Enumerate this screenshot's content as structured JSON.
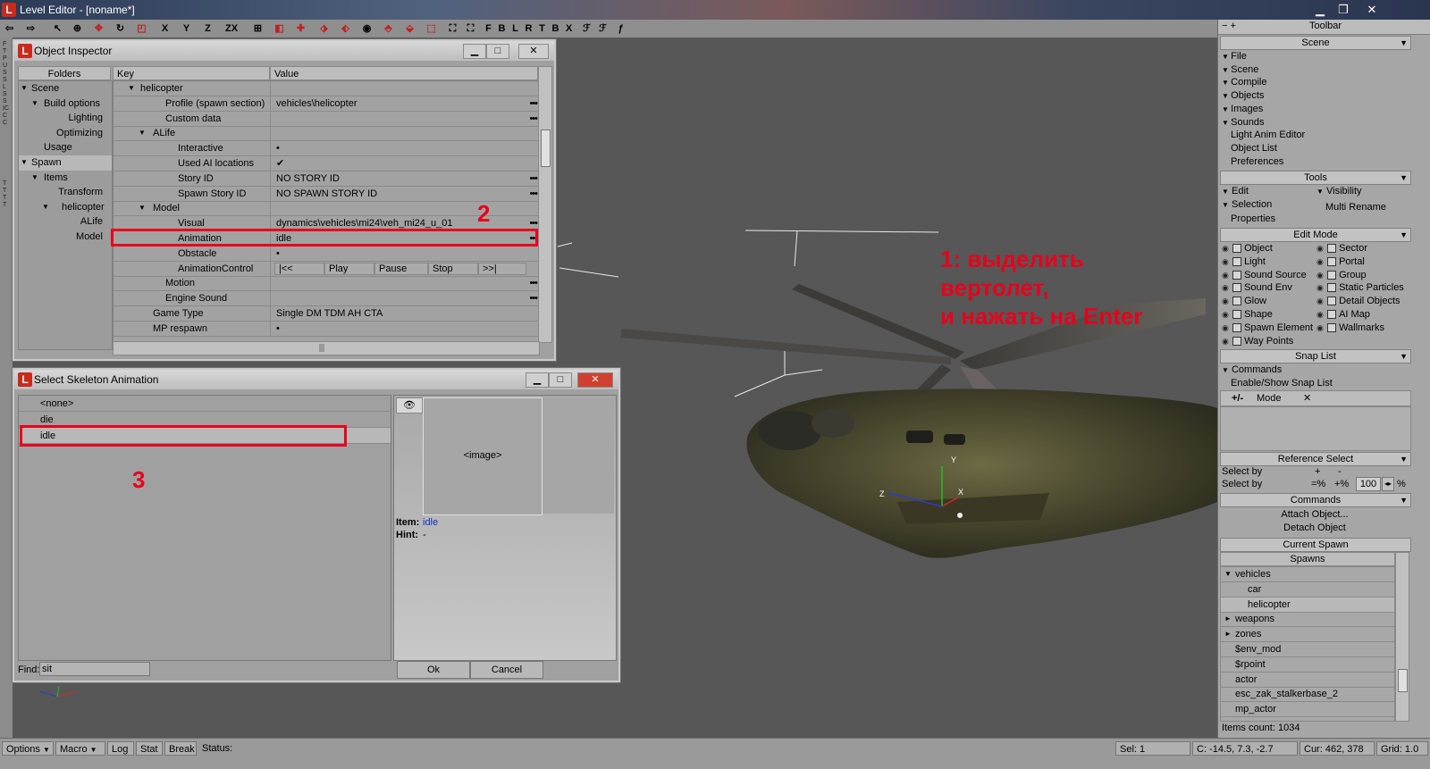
{
  "app": {
    "title": "Level Editor - [noname*]",
    "icon": "L"
  },
  "toolbar": {
    "letters": [
      "X",
      "Y",
      "Z",
      "ZX",
      "F",
      "B",
      "L",
      "R",
      "T",
      "B",
      "X"
    ]
  },
  "left_strip": {
    "top": "FTPUSSLSS ICCC",
    "bottom": "TTTT"
  },
  "inspector": {
    "title": "Object Inspector",
    "folders_header": "Folders",
    "key_header": "Key",
    "value_header": "Value",
    "folders": [
      {
        "label": "Scene",
        "indent": 0,
        "arrow": "▼"
      },
      {
        "label": "Build options",
        "indent": 1,
        "arrow": "▼"
      },
      {
        "label": "Lighting",
        "indent": 2,
        "arrow": ""
      },
      {
        "label": "Optimizing",
        "indent": 2,
        "arrow": ""
      },
      {
        "label": "Usage",
        "indent": 1,
        "arrow": ""
      },
      {
        "label": "Spawn",
        "indent": 0,
        "arrow": "▼",
        "selected": true
      },
      {
        "label": "Items",
        "indent": 1,
        "arrow": "▼"
      },
      {
        "label": "Transform",
        "indent": 2,
        "arrow": ""
      },
      {
        "label": "helicopter",
        "indent": 2,
        "arrow": "▼"
      },
      {
        "label": "ALife",
        "indent": 3,
        "arrow": ""
      },
      {
        "label": "Model",
        "indent": 3,
        "arrow": ""
      }
    ],
    "rows": [
      {
        "key": "helicopter",
        "value": "",
        "indent": 0,
        "arrow": "▼",
        "dots": false
      },
      {
        "key": "Profile (spawn section)",
        "value": "vehicles\\helicopter",
        "indent": 2,
        "arrow": "",
        "dots": true
      },
      {
        "key": "Custom data",
        "value": "",
        "indent": 2,
        "arrow": "",
        "dots": true
      },
      {
        "key": "ALife",
        "value": "",
        "indent": 1,
        "arrow": "▼",
        "dots": false
      },
      {
        "key": "Interactive",
        "value": "•",
        "indent": 3,
        "arrow": "",
        "dots": false
      },
      {
        "key": "Used AI locations",
        "value": "✔",
        "indent": 3,
        "arrow": "",
        "dots": false
      },
      {
        "key": "Story ID",
        "value": "NO STORY ID",
        "indent": 3,
        "arrow": "",
        "dots": true
      },
      {
        "key": "Spawn Story ID",
        "value": "NO SPAWN STORY ID",
        "indent": 3,
        "arrow": "",
        "dots": true
      },
      {
        "key": "Model",
        "value": "",
        "indent": 1,
        "arrow": "▼",
        "dots": false
      },
      {
        "key": "Visual",
        "value": "dynamics\\vehicles\\mi24\\veh_mi24_u_01",
        "indent": 3,
        "arrow": "",
        "dots": true
      },
      {
        "key": "Animation",
        "value": "idle",
        "indent": 3,
        "arrow": "",
        "dots": true
      },
      {
        "key": "Obstacle",
        "value": "•",
        "indent": 3,
        "arrow": "",
        "dots": false
      },
      {
        "key": "AnimationControl",
        "value": "",
        "indent": 3,
        "arrow": "",
        "dots": false
      },
      {
        "key": "Motion",
        "value": "",
        "indent": 2,
        "arrow": "",
        "dots": true
      },
      {
        "key": "Engine Sound",
        "value": "",
        "indent": 2,
        "arrow": "",
        "dots": true
      },
      {
        "key": "Game Type",
        "value": "Single DM TDM AH CTA",
        "indent": 1,
        "arrow": "",
        "dots": false
      },
      {
        "key": "MP respawn",
        "value": "•",
        "indent": 1,
        "arrow": "",
        "dots": false
      }
    ],
    "anim_controls": [
      "|<<",
      "Play",
      "Pause",
      "Stop",
      ">>|"
    ]
  },
  "skeleton": {
    "title": "Select Skeleton Animation",
    "items": [
      "<none>",
      "die",
      "idle"
    ],
    "selected": "idle",
    "image_placeholder": "<image>",
    "item_label": "Item:",
    "item_value": "idle",
    "hint_label": "Hint:",
    "hint_value": "-",
    "find_label": "Find:",
    "find_value": "sit",
    "ok_label": "Ok",
    "cancel_label": "Cancel"
  },
  "annotations": {
    "step1": [
      "1: выделить",
      "вертолет,",
      "и нажать на Enter"
    ],
    "step2": "2",
    "step3": "3"
  },
  "right_panel": {
    "toolbar_title": "Toolbar",
    "scene_header": "Scene",
    "scene_items": [
      {
        "label": "File",
        "arrow": true
      },
      {
        "label": "Scene",
        "arrow": true
      },
      {
        "label": "Compile",
        "arrow": true
      },
      {
        "label": "Objects",
        "arrow": true
      },
      {
        "label": "Images",
        "arrow": true
      },
      {
        "label": "Sounds",
        "arrow": true
      },
      {
        "label": "Light Anim Editor",
        "arrow": false
      },
      {
        "label": "Object List",
        "arrow": false
      },
      {
        "label": "Preferences",
        "arrow": false
      }
    ],
    "tools_header": "Tools",
    "tools": {
      "edit": "Edit",
      "visibility": "Visibility",
      "selection": "Selection",
      "multi_rename": "Multi Rename",
      "properties": "Properties"
    },
    "editmode_header": "Edit Mode",
    "editmode_left": [
      "Object",
      "Light",
      "Sound Source",
      "Sound Env",
      "Glow",
      "Shape",
      "Spawn Element",
      "Way Points"
    ],
    "editmode_right": [
      "Sector",
      "Portal",
      "Group",
      "Static Particles",
      "Detail Objects",
      "AI Map",
      "Wallmarks"
    ],
    "snap_header": "Snap List",
    "snap": {
      "commands": "Commands",
      "enable_show": "Enable/Show Snap List",
      "mode_prefix": "+/-",
      "mode": "Mode",
      "close": "✕"
    },
    "ref_header": "Reference Select",
    "ref": {
      "select_by_1": "Select by",
      "plus": "+",
      "minus": "-",
      "select_by_2": "Select by",
      "pct_minus": "=%",
      "pct_plus": "+%",
      "value": "100",
      "pct": "%"
    },
    "commands_header": "Commands",
    "commands": [
      "Attach Object...",
      "Detach Object"
    ],
    "current_spawn": "Current Spawn",
    "spawns_header": "Spawns",
    "spawns": [
      {
        "label": "vehicles",
        "indent": 0,
        "arrow": "▼"
      },
      {
        "label": "car",
        "indent": 2,
        "arrow": ""
      },
      {
        "label": "helicopter",
        "indent": 2,
        "arrow": "",
        "selected": true
      },
      {
        "label": "weapons",
        "indent": 0,
        "arrow": "►"
      },
      {
        "label": "zones",
        "indent": 0,
        "arrow": "►"
      },
      {
        "label": "$env_mod",
        "indent": 0,
        "arrow": ""
      },
      {
        "label": "$rpoint",
        "indent": 0,
        "arrow": ""
      },
      {
        "label": "actor",
        "indent": 0,
        "arrow": ""
      },
      {
        "label": "esc_zak_stalkerbase_2",
        "indent": 0,
        "arrow": ""
      },
      {
        "label": "mp_actor",
        "indent": 0,
        "arrow": ""
      }
    ],
    "items_count": "Items count: 1034"
  },
  "statusbar": {
    "options": "Options",
    "macro": "Macro",
    "log": "Log",
    "stat": "Stat",
    "break": "Break",
    "status": "Status:",
    "sel": "Sel: 1",
    "coords": "C: -14.5, 7.3, -2.7",
    "cur": "Cur: 462, 378",
    "grid": "Grid: 1.0"
  },
  "colors": {
    "annotation_red": "#e8001c",
    "viewport": "#575757",
    "panel": "#a6a6a6"
  }
}
